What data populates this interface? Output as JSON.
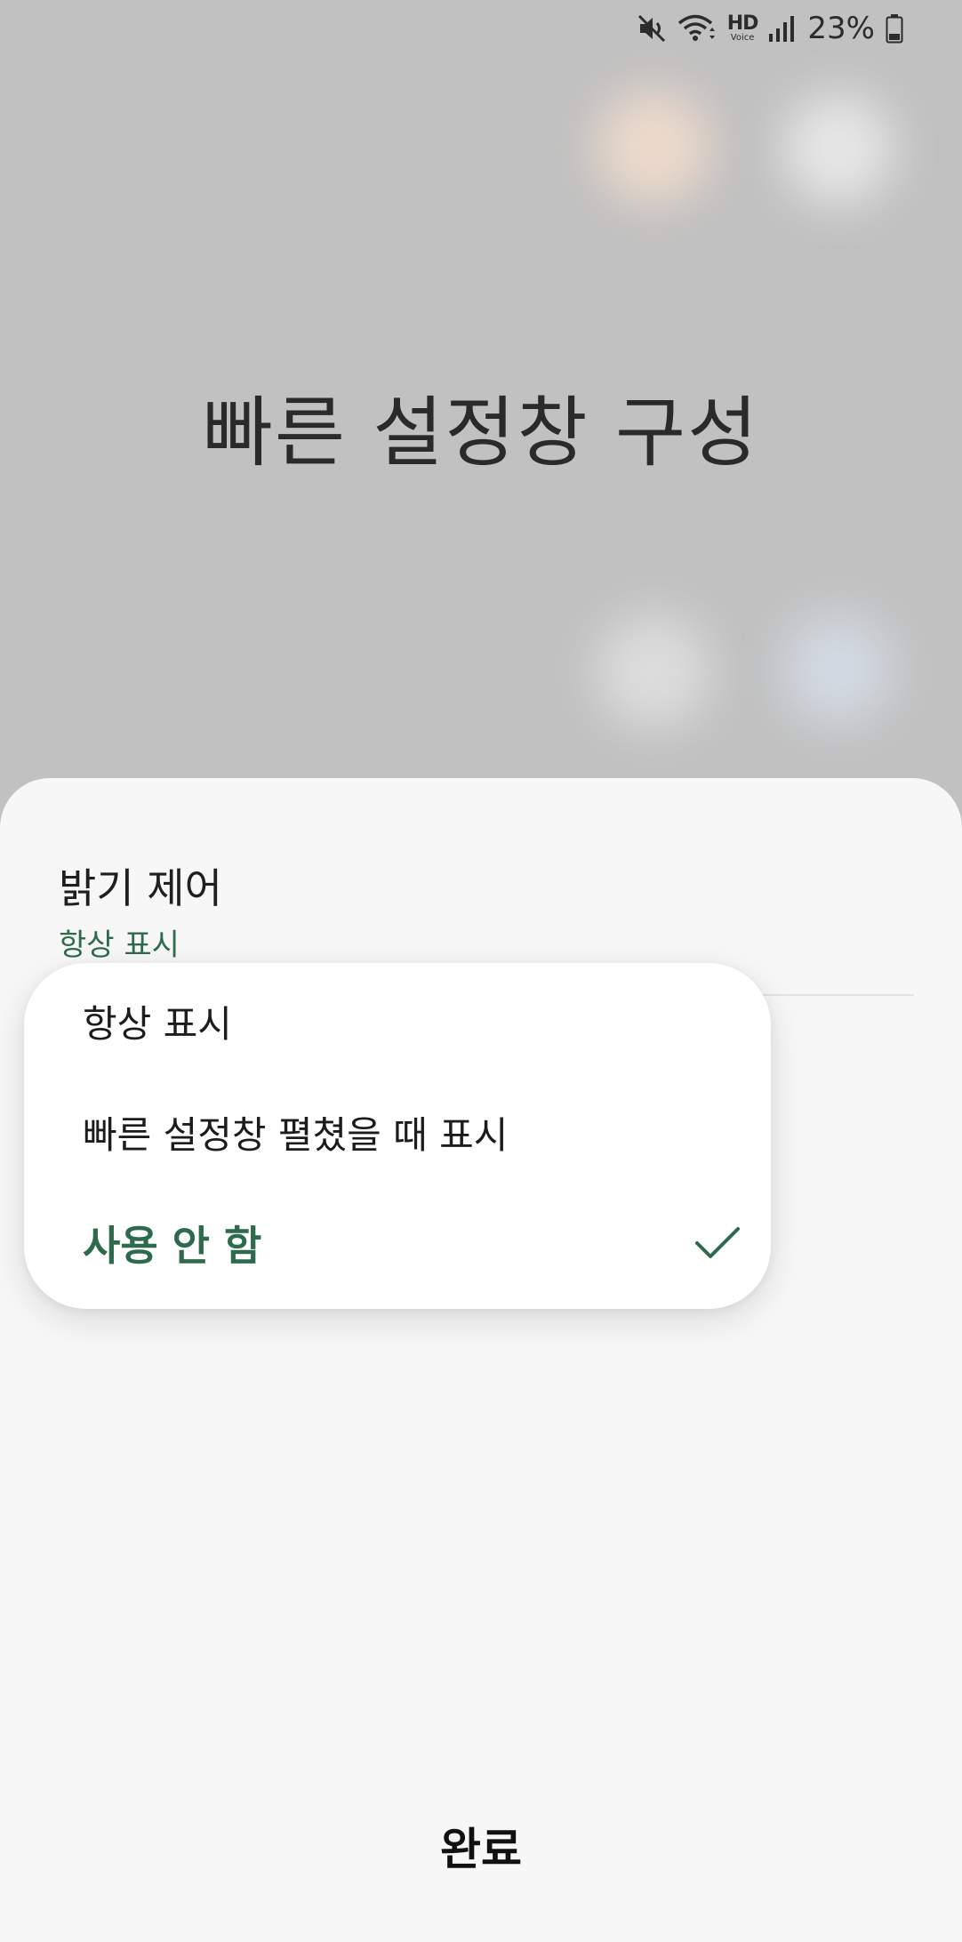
{
  "status_bar": {
    "battery_percent": "23%",
    "hd_label": "HD",
    "voice_label": "Voice",
    "icons": [
      "mute-icon",
      "wifi-icon",
      "hd-voice-icon",
      "signal-icon",
      "battery-icon"
    ]
  },
  "background": {
    "title": "빠른 설정창 구성"
  },
  "sheet": {
    "setting_title": "밝기 제어",
    "setting_summary": "항상 표시",
    "done_label": "완료"
  },
  "dropdown": {
    "options": [
      {
        "label": "항상 표시",
        "selected": false
      },
      {
        "label": "빠른 설정창 펼쳤을 때 표시",
        "selected": false
      },
      {
        "label": "사용 안 함",
        "selected": true
      }
    ]
  },
  "colors": {
    "accent": "#2e6b4a",
    "background": "#c1c1c1",
    "sheet": "#f7f7f7"
  }
}
